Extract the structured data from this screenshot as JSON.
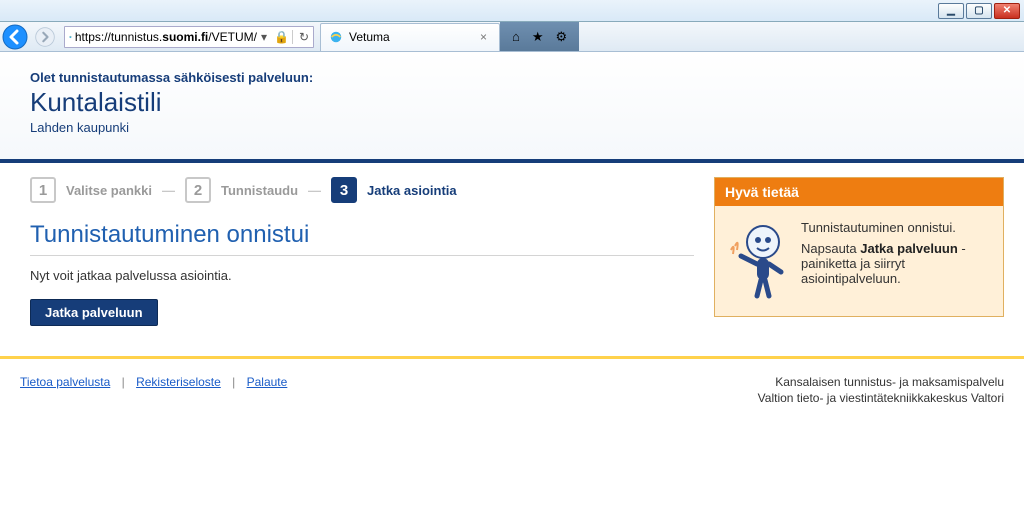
{
  "browser": {
    "url_prefix": "https://",
    "url_host": "tunnistus.",
    "url_bold": "suomi.fi",
    "url_path": "/VETUM/",
    "tab_title": "Vetuma"
  },
  "header": {
    "intro": "Olet tunnistautumassa sähköisesti palveluun:",
    "service": "Kuntalaistili",
    "org": "Lahden kaupunki"
  },
  "steps": {
    "s1_num": "1",
    "s1_label": "Valitse pankki",
    "s2_num": "2",
    "s2_label": "Tunnistaudu",
    "s3_num": "3",
    "s3_label": "Jatka asiointia"
  },
  "main": {
    "heading": "Tunnistautuminen onnistui",
    "body": "Nyt voit jatkaa palvelussa asiointia.",
    "button": "Jatka palveluun"
  },
  "infobox": {
    "title": "Hyvä tietää",
    "line1": "Tunnistautuminen onnistui.",
    "line2a": "Napsauta ",
    "line2b": "Jatka palveluun",
    "line2c": " -painiketta ja siirryt asiointipalveluun."
  },
  "footer": {
    "link1": "Tietoa palvelusta",
    "link2": "Rekisteriseloste",
    "link3": "Palaute",
    "right1": "Kansalaisen tunnistus- ja maksamispalvelu",
    "right2": "Valtion tieto- ja viestintätekniikkakeskus Valtori"
  }
}
